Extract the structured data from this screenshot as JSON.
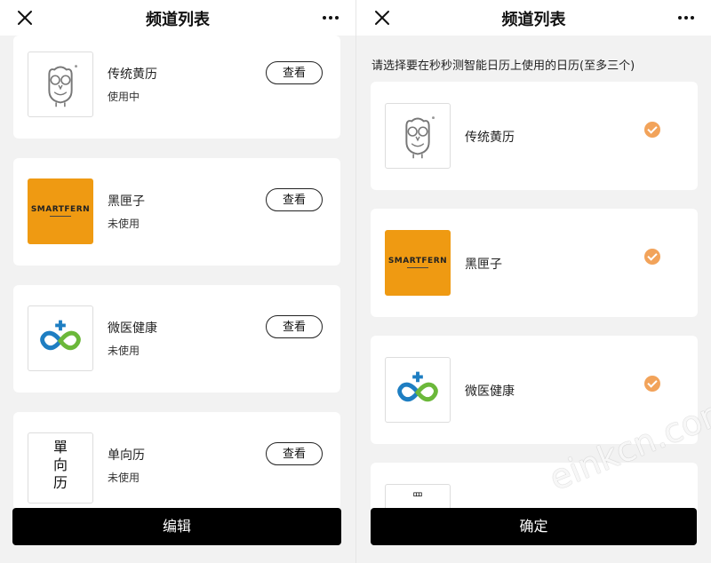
{
  "left": {
    "title": "频道列表",
    "channels": [
      {
        "name": "传统黄历",
        "status": "使用中",
        "button": "查看",
        "logo": "owl-logo"
      },
      {
        "name": "黑匣子",
        "status": "未使用",
        "button": "查看",
        "logo": "smartfern-logo",
        "logo_text": "SMARTFERN"
      },
      {
        "name": "微医健康",
        "status": "未使用",
        "button": "查看",
        "logo": "weiyi-logo"
      },
      {
        "name": "单向历",
        "status": "未使用",
        "button": "查看",
        "logo": "danxiang-logo",
        "logo_text": "單向历"
      }
    ],
    "bottom_button": "编辑"
  },
  "right": {
    "title": "频道列表",
    "instruction": "请选择要在秒秒测智能日历上使用的日历(至多三个)",
    "channels": [
      {
        "name": "传统黄历",
        "checked": true,
        "logo": "owl-logo"
      },
      {
        "name": "黑匣子",
        "checked": true,
        "logo": "smartfern-logo",
        "logo_text": "SMARTFERN"
      },
      {
        "name": "微医健康",
        "checked": true,
        "logo": "weiyi-logo"
      },
      {
        "name": "",
        "checked": false,
        "logo": "danxiang-logo"
      }
    ],
    "bottom_button": "确定"
  },
  "watermark": "einkcn.com",
  "colors": {
    "check": "#f2a35a",
    "smartfern": "#ef9a12",
    "button_bg": "#000000"
  }
}
